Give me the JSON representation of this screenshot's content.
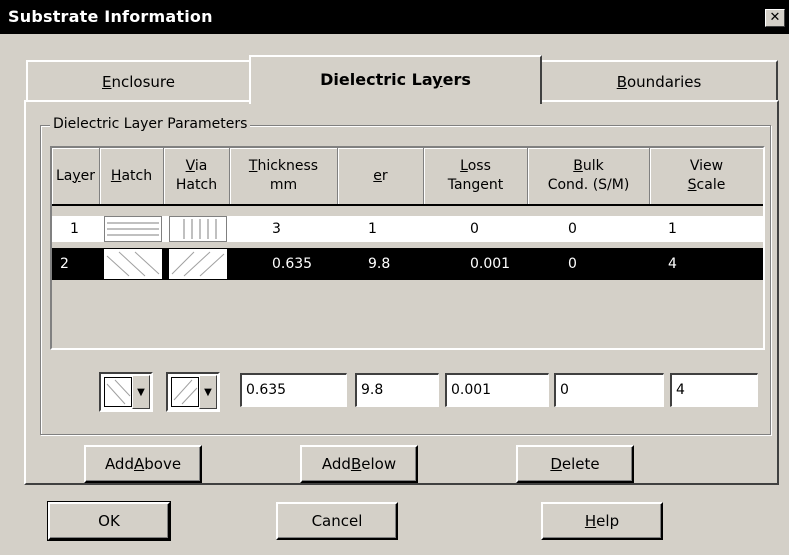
{
  "window": {
    "title": "Substrate Information",
    "close_glyph": "✕"
  },
  "tabs": [
    {
      "pre": "",
      "key": "E",
      "post": "nclosure"
    },
    {
      "pre": "Dielectric La",
      "key": "y",
      "post": "ers"
    },
    {
      "pre": "",
      "key": "B",
      "post": "oundaries"
    }
  ],
  "group": {
    "label": "Dielectric Layer Parameters"
  },
  "table": {
    "headers": {
      "layer": {
        "pre": "La",
        "key": "y",
        "post": "er"
      },
      "hatch": {
        "pre": "",
        "key": "H",
        "post": "atch"
      },
      "via_hatch": {
        "line1_pre": "",
        "line1_key": "V",
        "line1_post": "ia",
        "line2": "Hatch"
      },
      "thickness": {
        "line1_pre": "",
        "line1_key": "T",
        "line1_post": "hickness",
        "line2": "mm"
      },
      "er": {
        "pre": "",
        "key": "e",
        "post": "r"
      },
      "loss": {
        "line1_pre": "",
        "line1_key": "L",
        "line1_post": "oss",
        "line2": "Tangent"
      },
      "bulk": {
        "line1_pre": "",
        "line1_key": "B",
        "line1_post": "ulk",
        "line2": "Cond. (S/M)"
      },
      "view": {
        "line1": "View",
        "line2_pre": "",
        "line2_key": "S",
        "line2_post": "cale"
      }
    },
    "rows": [
      {
        "layer": "1",
        "thickness": "3",
        "er": "1",
        "loss": "0",
        "bulk": "0",
        "scale": "1"
      },
      {
        "layer": "2",
        "thickness": "0.635",
        "er": "9.8",
        "loss": "0.001",
        "bulk": "0",
        "scale": "4"
      }
    ]
  },
  "editor": {
    "thickness": "0.635",
    "er": "9.8",
    "loss": "0.001",
    "bulk": "0",
    "scale": "4",
    "dropdown_glyph": "▼"
  },
  "actions": {
    "add_above": {
      "pre": "Add ",
      "key": "A",
      "post": "bove"
    },
    "add_below": {
      "pre": "Add ",
      "key": "B",
      "post": "elow"
    },
    "delete": {
      "pre": "",
      "key": "D",
      "post": "elete"
    }
  },
  "footer": {
    "ok": "OK",
    "cancel": "Cancel",
    "help": {
      "pre": "",
      "key": "H",
      "post": "elp"
    }
  },
  "colors": {
    "face": "#d4d0c8",
    "selection": "#000000",
    "title_bar": "#000000"
  }
}
